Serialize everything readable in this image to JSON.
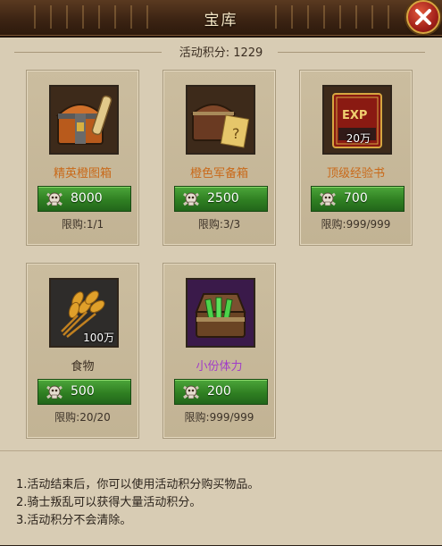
{
  "window": {
    "title": "宝库"
  },
  "points": {
    "label": "活动积分: 1229"
  },
  "colors": {
    "orange_name": "#c96a1a",
    "purple_name": "#a03cc8",
    "dark_name": "#3b2e22",
    "button_green": "#2f7f22"
  },
  "items": [
    {
      "name": "精英橙图箱",
      "price": "8000",
      "limit": "限购:1/1",
      "icon": "orange-chest-with-scroll-icon",
      "name_color": "orange"
    },
    {
      "name": "橙色军备箱",
      "price": "2500",
      "limit": "限购:3/3",
      "icon": "equipment-chest-icon",
      "name_color": "orange"
    },
    {
      "name": "顶级经验书",
      "price": "700",
      "limit": "限购:999/999",
      "icon": "exp-book-icon",
      "badge": "20万",
      "name_color": "orange"
    },
    {
      "name": "食物",
      "price": "500",
      "limit": "限购:20/20",
      "icon": "wheat-icon",
      "badge": "100万",
      "name_color": "dark"
    },
    {
      "name": "小份体力",
      "price": "200",
      "limit": "限购:999/999",
      "icon": "stamina-chest-icon",
      "name_color": "purple"
    }
  ],
  "book_label": "EXP",
  "notes": [
    "1.活动结束后，你可以使用活动积分购买物品。",
    "2.骑士叛乱可以获得大量活动积分。",
    "3.活动积分不会清除。"
  ]
}
